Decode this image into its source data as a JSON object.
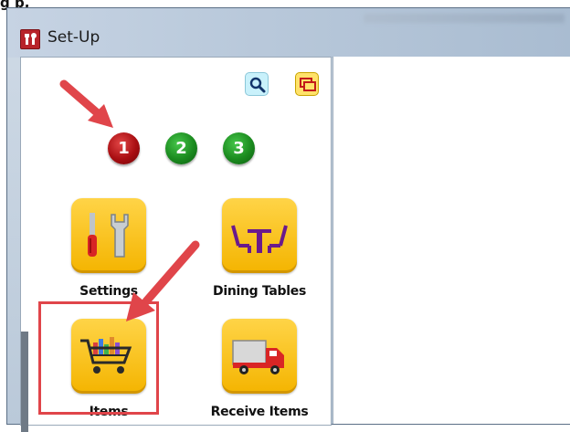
{
  "caption": {
    "text": "g      p,"
  },
  "window": {
    "title": "Set-Up"
  },
  "toolbar": {
    "search_icon": "search-icon",
    "copy_icon": "copy-windows-icon"
  },
  "pages": [
    {
      "label": "1",
      "color": "#b5161a",
      "active": true
    },
    {
      "label": "2",
      "color": "#1f8f22",
      "active": false
    },
    {
      "label": "3",
      "color": "#1f8f22",
      "active": false
    }
  ],
  "tiles": [
    {
      "label": "Settings",
      "icon": "tools-icon"
    },
    {
      "label": "Dining Tables",
      "icon": "dining-table-icon"
    },
    {
      "label": "Items",
      "icon": "shopping-cart-icon"
    },
    {
      "label": "Receive Items",
      "icon": "delivery-truck-icon"
    }
  ],
  "annotations": {
    "arrow_color": "#e0454a",
    "highlight_color": "#e0454a"
  }
}
